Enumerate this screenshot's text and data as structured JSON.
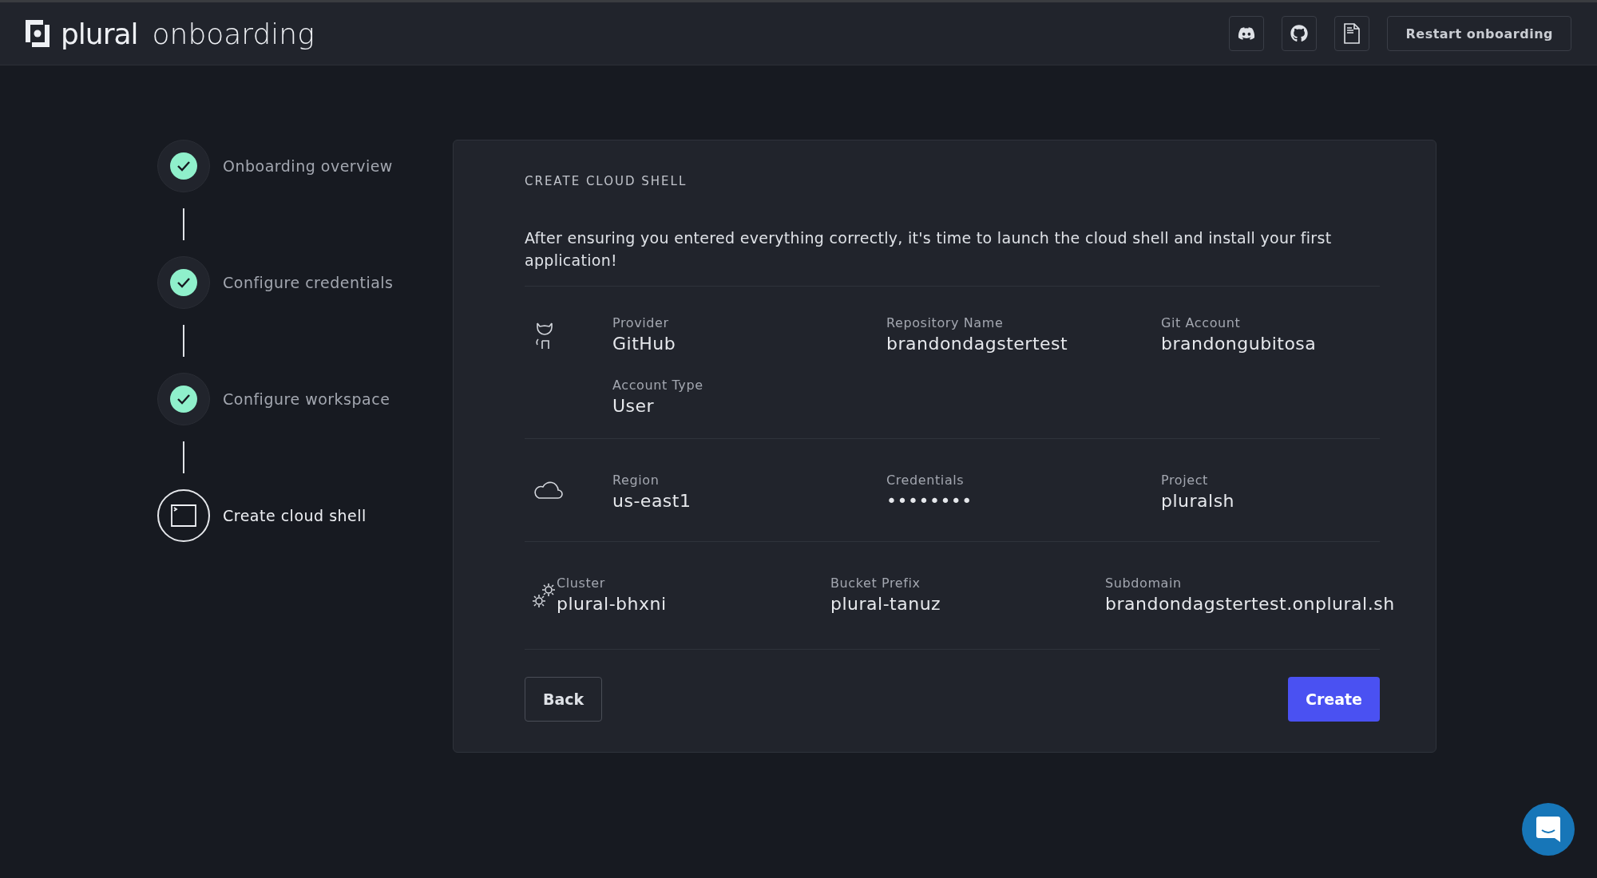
{
  "header": {
    "logo_text": "plural",
    "title": "onboarding",
    "icon_buttons": [
      {
        "kind": "discord"
      },
      {
        "kind": "github"
      },
      {
        "kind": "docs"
      }
    ],
    "restart_button": "Restart onboarding"
  },
  "steps": [
    {
      "label": "Onboarding overview",
      "kind": "completed",
      "selected": false
    },
    {
      "label": "Configure credentials",
      "kind": "completed",
      "selected": false
    },
    {
      "label": "Configure workspace",
      "kind": "completed",
      "selected": false
    },
    {
      "label": "Create cloud shell",
      "kind": "current",
      "selected": true
    }
  ],
  "card": {
    "heading": "CREATE CLOUD SHELL",
    "description": "After ensuring you entered everything correctly, it's time to launch the cloud shell and install your first application!",
    "sections": [
      {
        "kind": "git",
        "fields": [
          {
            "label": "Provider",
            "value": "GitHub"
          },
          {
            "label": "Repository Name",
            "value": "brandondagstertest"
          },
          {
            "label": "Git Account",
            "value": "brandongubitosa"
          },
          {
            "label": "Account Type",
            "value": "User"
          }
        ]
      },
      {
        "kind": "cloud",
        "fields": [
          {
            "label": "Region",
            "value": "us-east1"
          },
          {
            "label": "Credentials",
            "value": "••••••••"
          },
          {
            "label": "Project",
            "value": "pluralsh"
          }
        ]
      },
      {
        "kind": "gears",
        "fields": [
          {
            "label": "Cluster",
            "value": "plural-bhxni"
          },
          {
            "label": "Bucket Prefix",
            "value": "plural-tanuz"
          },
          {
            "label": "Subdomain",
            "value": "brandondagstertest.onplural.sh"
          }
        ]
      }
    ],
    "back_button": "Back",
    "create_button": "Create"
  }
}
